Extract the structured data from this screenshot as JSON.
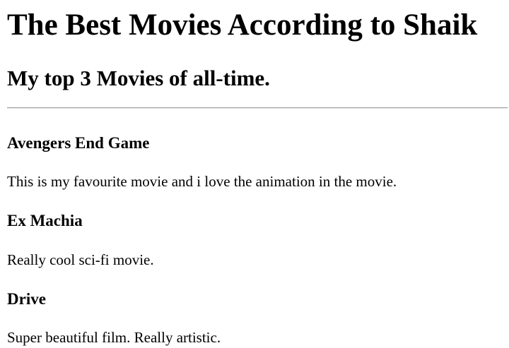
{
  "page": {
    "title": "The Best Movies According to Shaik",
    "subtitle": "My top 3 Movies of all-time."
  },
  "movies": [
    {
      "title": "Avengers End Game",
      "description": "This is my favourite movie and i love the animation in the movie."
    },
    {
      "title": "Ex Machia",
      "description": "Really cool sci-fi movie."
    },
    {
      "title": "Drive",
      "description": "Super beautiful film. Really artistic."
    }
  ]
}
